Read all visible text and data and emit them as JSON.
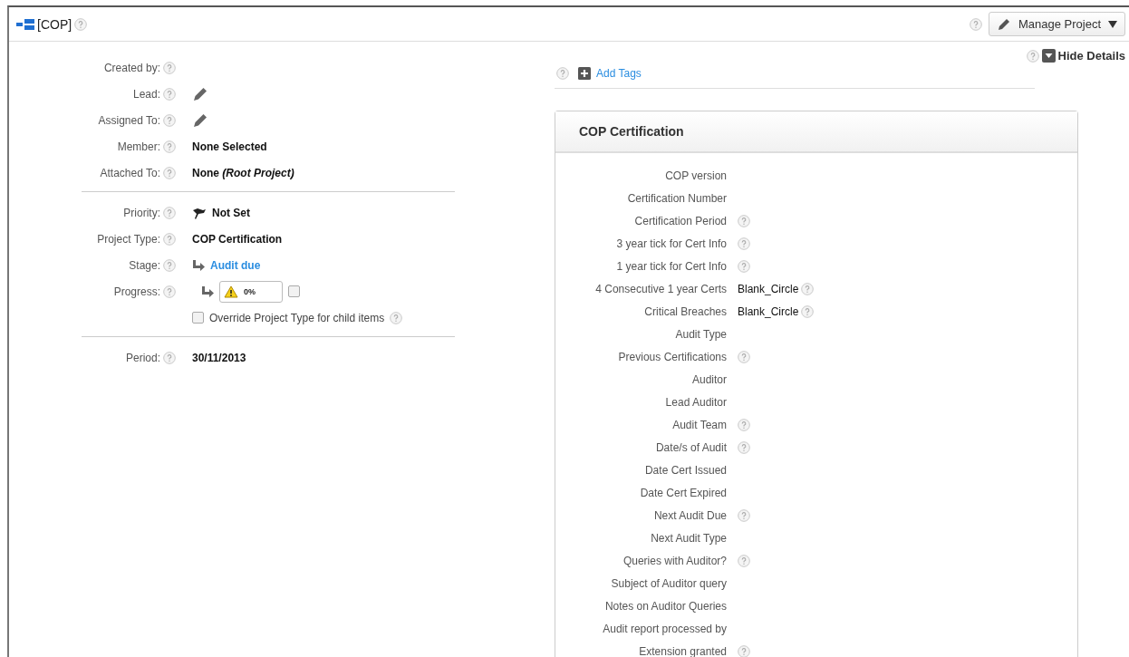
{
  "header": {
    "title": "[COP]",
    "manage_button": "Manage Project"
  },
  "hide_details": {
    "label": "Hide Details"
  },
  "left_sections": [
    [
      {
        "kind": "empty",
        "label": "Created by:"
      },
      {
        "kind": "edit",
        "label": "Lead:"
      },
      {
        "kind": "edit",
        "label": "Assigned To:"
      },
      {
        "kind": "text",
        "label": "Member:",
        "value": "None Selected"
      },
      {
        "kind": "text",
        "label": "Attached To:",
        "value": "None *(Root Project)*"
      }
    ],
    [
      {
        "kind": "priority",
        "label": "Priority:",
        "value": "Not Set"
      },
      {
        "kind": "text",
        "label": "Project Type:",
        "value": "COP Certification"
      },
      {
        "kind": "stage",
        "label": "Stage:",
        "value": "Audit due"
      },
      {
        "kind": "progress",
        "label": "Progress:",
        "value": "0%",
        "checked": false
      },
      {
        "kind": "checkbox",
        "value": "Override Project Type for child items",
        "checked": false
      }
    ],
    [
      {
        "kind": "text",
        "label": "Period:",
        "value": "30/11/2013"
      }
    ]
  ],
  "tags": {
    "link": "Add Tags"
  },
  "panel": {
    "title": "COP Certification",
    "rows": [
      {
        "label": "COP version",
        "help": false
      },
      {
        "label": "Certification Number",
        "help": false
      },
      {
        "label": "Certification Period",
        "help": true
      },
      {
        "label": "3 year tick for Cert Info",
        "help": true
      },
      {
        "label": "1 year tick for Cert Info",
        "help": true
      },
      {
        "label": "4 Consecutive 1 year Certs",
        "value": "Blank_Circle",
        "help": true
      },
      {
        "label": "Critical Breaches",
        "value": "Blank_Circle",
        "help": true
      },
      {
        "label": "Audit Type",
        "help": false
      },
      {
        "label": "Previous Certifications",
        "help": true
      },
      {
        "label": "Auditor",
        "help": false
      },
      {
        "label": "Lead Auditor",
        "help": false
      },
      {
        "label": "Audit Team",
        "help": true
      },
      {
        "label": "Date/s of Audit",
        "help": true
      },
      {
        "label": "Date Cert Issued",
        "help": false
      },
      {
        "label": "Date Cert Expired",
        "help": false
      },
      {
        "label": "Next Audit Due",
        "help": true
      },
      {
        "label": "Next Audit Type",
        "help": false
      },
      {
        "label": "Queries with Auditor?",
        "help": true
      },
      {
        "label": "Subject of Auditor query",
        "help": false
      },
      {
        "label": "Notes on Auditor Queries",
        "help": false
      },
      {
        "label": "Audit report processed by",
        "help": false
      },
      {
        "label": "Extension granted",
        "help": true
      }
    ]
  }
}
